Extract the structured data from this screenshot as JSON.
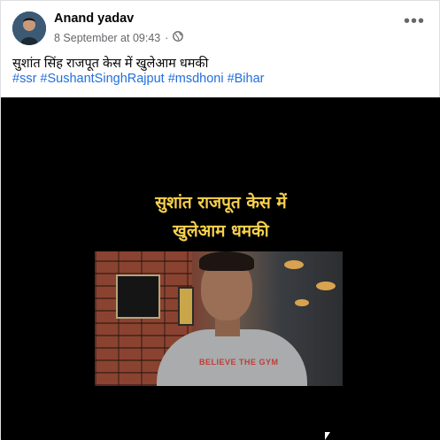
{
  "post": {
    "author": "Anand yadav",
    "timestamp": "8 September at 09:43",
    "separator": "·",
    "audience_icon": "globe-icon",
    "more_icon": "more-options-icon",
    "more_glyph": "•••",
    "text": "सुशांत सिंह राजपूत केस में खुलेआम धमकी",
    "hashtags": [
      "#ssr",
      "#SushantSinghRajput",
      "#msdhoni",
      "#Bihar"
    ]
  },
  "video": {
    "caption_line1": "सुशांत राजपूत केस में",
    "caption_line2": "खुलेआम धमकी",
    "caption_color": "#f7d14c",
    "shirt_text": "BELIEVE THE GYM"
  },
  "colors": {
    "link": "#216fdb",
    "secondary_text": "#65676b",
    "video_bg": "#000000"
  }
}
